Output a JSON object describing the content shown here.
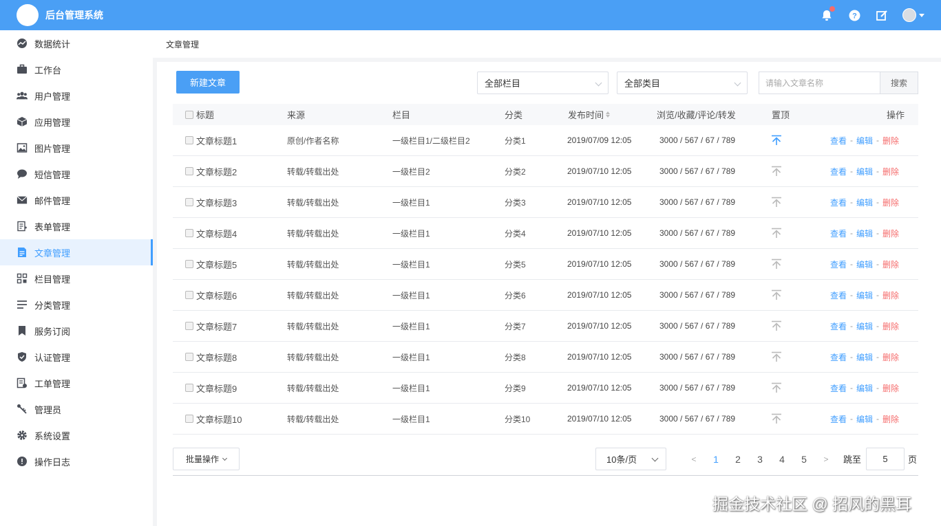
{
  "app": {
    "title": "后台管理系统"
  },
  "topbar": {
    "icons": [
      "bell-icon",
      "help-icon",
      "edit-icon",
      "avatar"
    ]
  },
  "sidebar": {
    "items": [
      {
        "label": "数据统计",
        "icon": "dashboard-icon"
      },
      {
        "label": "工作台",
        "icon": "briefcase-icon"
      },
      {
        "label": "用户管理",
        "icon": "users-icon"
      },
      {
        "label": "应用管理",
        "icon": "cube-icon"
      },
      {
        "label": "图片管理",
        "icon": "image-icon"
      },
      {
        "label": "短信管理",
        "icon": "chat-icon"
      },
      {
        "label": "邮件管理",
        "icon": "mail-icon"
      },
      {
        "label": "表单管理",
        "icon": "form-icon"
      },
      {
        "label": "文章管理",
        "icon": "article-icon",
        "active": true
      },
      {
        "label": "栏目管理",
        "icon": "grid-icon"
      },
      {
        "label": "分类管理",
        "icon": "list-icon"
      },
      {
        "label": "服务订阅",
        "icon": "bookmark-icon"
      },
      {
        "label": "认证管理",
        "icon": "shield-icon"
      },
      {
        "label": "工单管理",
        "icon": "ticket-icon"
      },
      {
        "label": "管理员",
        "icon": "key-icon"
      },
      {
        "label": "系统设置",
        "icon": "gear-icon"
      },
      {
        "label": "操作日志",
        "icon": "log-icon"
      }
    ]
  },
  "breadcrumb": "文章管理",
  "toolbar": {
    "new_button": "新建文章",
    "column_select": "全部栏目",
    "category_select": "全部类目",
    "search_placeholder": "请输入文章名称",
    "search_button": "搜索"
  },
  "table": {
    "headers": {
      "title": "标题",
      "source": "来源",
      "column": "栏目",
      "category": "分类",
      "time": "发布时间",
      "stats": "浏览/收藏/评论/转发",
      "top": "置顶",
      "ops": "操作"
    },
    "actions": {
      "view": "查看",
      "edit": "编辑",
      "delete": "删除",
      "sep": "-"
    },
    "rows": [
      {
        "title": "文章标题1",
        "source": "原创/作者名称",
        "column": "一级栏目1/二级栏目2",
        "category": "分类1",
        "time": "2019/07/09 12:05",
        "stats": "3000 / 567 / 67 / 789",
        "pinned": true
      },
      {
        "title": "文章标题2",
        "source": "转载/转载出处",
        "column": "一级栏目2",
        "category": "分类2",
        "time": "2019/07/10 12:05",
        "stats": "3000 / 567 / 67 / 789",
        "pinned": false
      },
      {
        "title": "文章标题3",
        "source": "转载/转载出处",
        "column": "一级栏目1",
        "category": "分类3",
        "time": "2019/07/10 12:05",
        "stats": "3000 / 567 / 67 / 789",
        "pinned": false
      },
      {
        "title": "文章标题4",
        "source": "转载/转载出处",
        "column": "一级栏目1",
        "category": "分类4",
        "time": "2019/07/10 12:05",
        "stats": "3000 / 567 / 67 / 789",
        "pinned": false
      },
      {
        "title": "文章标题5",
        "source": "转载/转载出处",
        "column": "一级栏目1",
        "category": "分类5",
        "time": "2019/07/10 12:05",
        "stats": "3000 / 567 / 67 / 789",
        "pinned": false
      },
      {
        "title": "文章标题6",
        "source": "转载/转载出处",
        "column": "一级栏目1",
        "category": "分类6",
        "time": "2019/07/10 12:05",
        "stats": "3000 / 567 / 67 / 789",
        "pinned": false
      },
      {
        "title": "文章标题7",
        "source": "转载/转载出处",
        "column": "一级栏目1",
        "category": "分类7",
        "time": "2019/07/10 12:05",
        "stats": "3000 / 567 / 67 / 789",
        "pinned": false
      },
      {
        "title": "文章标题8",
        "source": "转载/转载出处",
        "column": "一级栏目1",
        "category": "分类8",
        "time": "2019/07/10 12:05",
        "stats": "3000 / 567 / 67 / 789",
        "pinned": false
      },
      {
        "title": "文章标题9",
        "source": "转载/转载出处",
        "column": "一级栏目1",
        "category": "分类9",
        "time": "2019/07/10 12:05",
        "stats": "3000 / 567 / 67 / 789",
        "pinned": false
      },
      {
        "title": "文章标题10",
        "source": "转载/转载出处",
        "column": "一级栏目1",
        "category": "分类10",
        "time": "2019/07/10 12:05",
        "stats": "3000 / 567 / 67 / 789",
        "pinned": false
      }
    ]
  },
  "footer": {
    "batch_button": "批量操作",
    "page_size": "10条/页",
    "prev": "<",
    "next": ">",
    "pages": [
      "1",
      "2",
      "3",
      "4",
      "5"
    ],
    "current_page": "1",
    "jump_label": "跳至",
    "jump_value": "5",
    "jump_unit": "页"
  },
  "colors": {
    "primary": "#4a9ff5",
    "link": "#409eff",
    "danger": "#f56c6c"
  },
  "watermark": "掘金技术社区 @ 招风的黑耳"
}
